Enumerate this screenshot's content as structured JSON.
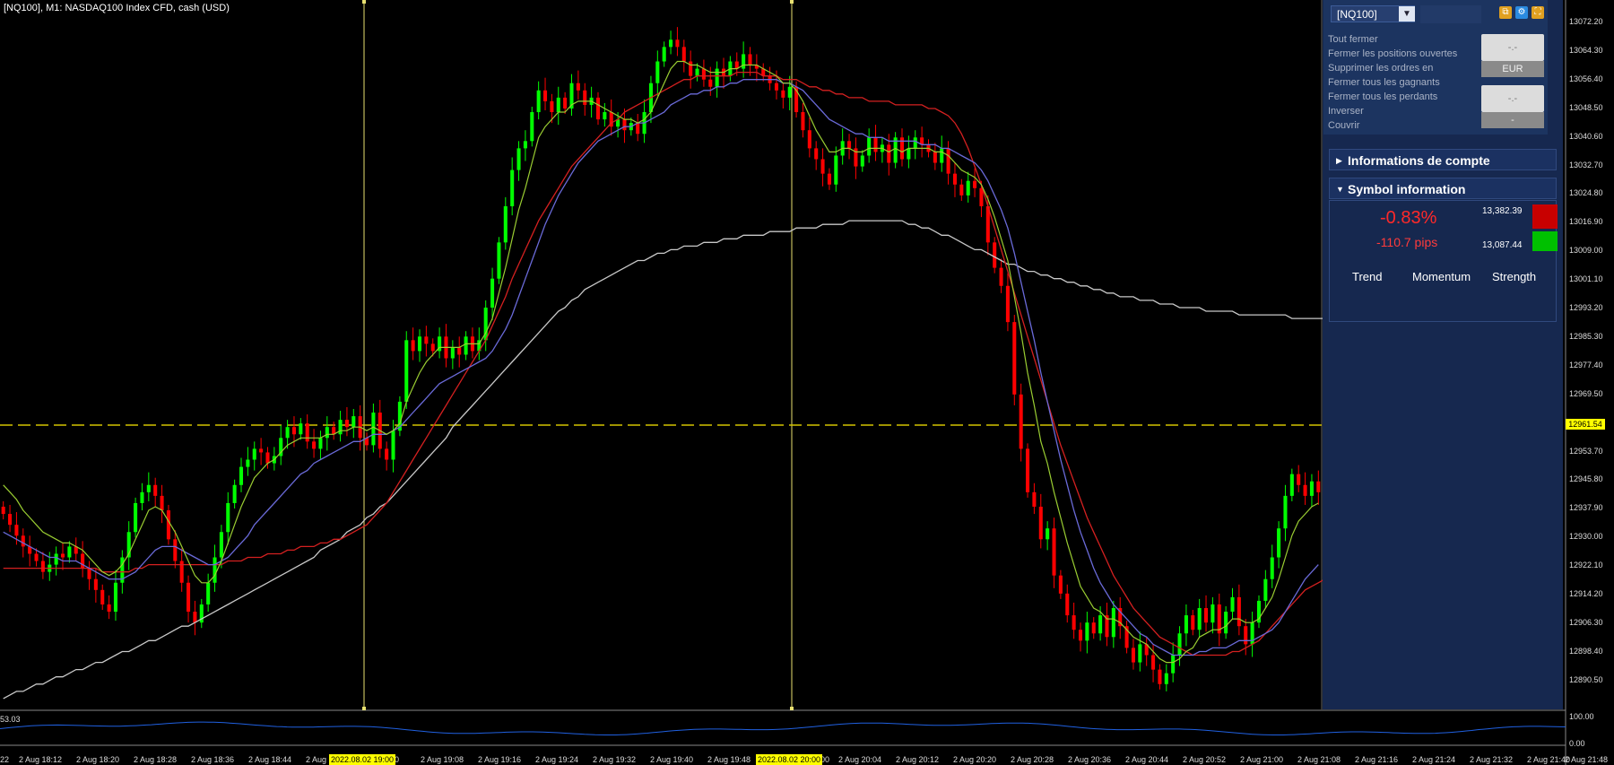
{
  "chart_title": "[NQ100], M1:  NASDAQ100 Index CFD, cash (USD)",
  "oscillator_label": "53.03",
  "colors": {
    "bull": "#00ff00",
    "bear": "#ff0000",
    "ma_fast": "#9acd32",
    "ma_mid": "#6a6ad8",
    "ma_slow": "#d42020",
    "ma_long": "#c8c8c8",
    "hline": "#d4c400",
    "vline": "#e8e070",
    "osc": "#2060e0",
    "panel": "#16284f"
  },
  "panel": {
    "symbol": "[NQ100]",
    "actions": [
      "Tout fermer",
      "Fermer les positions ouvertes",
      "Supprimer les ordres en",
      "Fermer tous les gagnants",
      "Fermer tous les perdants",
      "Inverser",
      "Couvrir"
    ],
    "btn1": "-.-",
    "btn1_sub": "EUR",
    "btn2": "-.-",
    "btn2_sub": "-",
    "section_account": "Informations de compte",
    "section_symbol": "Symbol information",
    "change_pct": "-0.83%",
    "change_pips": "-110.7 pips",
    "price_high": "13,382.39",
    "price_low": "13,087.44",
    "indicators": [
      "Trend",
      "Momentum",
      "Strength"
    ]
  },
  "price_axis": {
    "ticks": [
      "13072.20",
      "13064.30",
      "13056.40",
      "13048.50",
      "13040.60",
      "13032.70",
      "13024.80",
      "13016.90",
      "13009.00",
      "13001.10",
      "12993.20",
      "12985.30",
      "12977.40",
      "12969.50",
      "12961.54",
      "12953.70",
      "12945.80",
      "12937.90",
      "12930.00",
      "12922.10",
      "12914.20",
      "12906.30",
      "12898.40",
      "12890.50"
    ],
    "current": "12961.54"
  },
  "osc_axis": [
    "100.00",
    "0.00"
  ],
  "time_axis": {
    "ticks": [
      "22",
      "2 Aug 18:12",
      "2 Aug 18:20",
      "2 Aug 18:28",
      "2 Aug 18:36",
      "2 Aug 18:44",
      "2 Aug",
      "00",
      "2 Aug 19:08",
      "2 Aug 19:16",
      "2 Aug 19:24",
      "2 Aug 19:32",
      "2 Aug 19:40",
      "2 Aug 19:48",
      "00",
      "2 Aug 20:04",
      "2 Aug 20:12",
      "2 Aug 20:20",
      "2 Aug 20:28",
      "2 Aug 20:36",
      "2 Aug 20:44",
      "2 Aug 20:52",
      "2 Aug 21:00",
      "2 Aug 21:08",
      "2 Aug 21:16",
      "2 Aug 21:24",
      "2 Aug 21:32",
      "2 Aug 21:40",
      "2 Aug 21:48"
    ],
    "highlight1": "2022.08.02 19:00",
    "highlight2": "2022.08.02 20:00"
  },
  "chart_data": {
    "type": "candlestick",
    "title": "[NQ100], M1:  NASDAQ100 Index CFD, cash (USD)",
    "ylim": [
      12884,
      13076
    ],
    "current_price": 12961.54,
    "vertical_markers": [
      "2022.08.02 19:00",
      "2022.08.02 20:00"
    ],
    "close": [
      12937,
      12934,
      12931,
      12928,
      12926,
      12924,
      12921,
      12923,
      12926,
      12925,
      12928,
      12926,
      12922,
      12919,
      12916,
      12912,
      12910,
      12918,
      12925,
      12932,
      12940,
      12943,
      12945,
      12942,
      12938,
      12930,
      12924,
      12918,
      12910,
      12907,
      12912,
      12918,
      12925,
      12932,
      12940,
      12945,
      12950,
      12952,
      12955,
      12954,
      12951,
      12953,
      12958,
      12961,
      12959,
      12962,
      12957,
      12955,
      12958,
      12961,
      12959,
      12963,
      12961,
      12964,
      12958,
      12956,
      12965,
      12955,
      12952,
      12960,
      12968,
      12985,
      12982,
      12986,
      12984,
      12982,
      12986,
      12980,
      12983,
      12981,
      12986,
      12982,
      12985,
      12994,
      13002,
      13012,
      13022,
      13032,
      13038,
      13040,
      13048,
      13054,
      13051,
      13048,
      13052,
      13049,
      13056,
      13054,
      13050,
      13052,
      13046,
      13048,
      13044,
      13046,
      13043,
      13045,
      13042,
      13048,
      13056,
      13062,
      13066,
      13068,
      13066,
      13062,
      13058,
      13060,
      13057,
      13055,
      13060,
      13058,
      13062,
      13060,
      13064,
      13061,
      13060,
      13058,
      13056,
      13054,
      13052,
      13055,
      13048,
      13043,
      13038,
      13035,
      13031,
      13028,
      13036,
      13040,
      13038,
      13033,
      13036,
      13041,
      13037,
      13039,
      13034,
      13041,
      13035,
      13038,
      13041,
      13039,
      13037,
      13034,
      13038,
      13031,
      13028,
      13025,
      13029,
      13027,
      13022,
      13012,
      13005,
      13000,
      12990,
      12970,
      12955,
      12943,
      12939,
      12930,
      12933,
      12920,
      12915,
      12909,
      12905,
      12902,
      12907,
      12904,
      12909,
      12903,
      12911,
      12906,
      12900,
      12896,
      12901,
      12898,
      12894,
      12890,
      12893,
      12898,
      12904,
      12909,
      12905,
      12911,
      12907,
      12912,
      12904,
      12910,
      12914,
      12906,
      12901,
      12907,
      12913,
      12919,
      12925,
      12933,
      12942,
      12948,
      12945,
      12942,
      12946,
      12943
    ],
    "ma_fast": [
      12945,
      12943,
      12941,
      12938,
      12936,
      12934,
      12932,
      12931,
      12930,
      12929,
      12929,
      12928,
      12927,
      12925,
      12923,
      12921,
      12920,
      12921,
      12923,
      12926,
      12930,
      12934,
      12938,
      12939,
      12938,
      12935,
      12932,
      12928,
      12924,
      12920,
      12918,
      12918,
      12920,
      12924,
      12929,
      12934,
      12939,
      12943,
      12947,
      12949,
      12951,
      12952,
      12954,
      12956,
      12957,
      12958,
      12958,
      12958,
      12958,
      12959,
      12959,
      12960,
      12960,
      12961,
      12961,
      12960,
      12961,
      12960,
      12959,
      12960,
      12962,
      12968,
      12972,
      12976,
      12979,
      12981,
      12983,
      12983,
      12983,
      12983,
      12984,
      12984,
      12984,
      12987,
      12991,
      12998,
      13005,
      13013,
      13021,
      13027,
      13034,
      13041,
      13044,
      13046,
      13048,
      13048,
      13050,
      13051,
      13051,
      13051,
      13050,
      13049,
      13048,
      13047,
      13046,
      13046,
      13045,
      13046,
      13048,
      13052,
      13056,
      13060,
      13062,
      13062,
      13061,
      13061,
      13060,
      13059,
      13059,
      13059,
      13060,
      13060,
      13061,
      13061,
      13061,
      13060,
      13059,
      13058,
      13056,
      13056,
      13054,
      13051,
      13047,
      13043,
      13040,
      13037,
      13037,
      13038,
      13038,
      13037,
      13037,
      13038,
      13038,
      13038,
      13037,
      13038,
      13037,
      13038,
      13038,
      13038,
      13038,
      13037,
      13037,
      13036,
      13034,
      13032,
      13031,
      13030,
      13028,
      13024,
      13019,
      13013,
      13007,
      12997,
      12987,
      12976,
      12967,
      12957,
      12951,
      12943,
      12936,
      12929,
      12923,
      12917,
      12914,
      12911,
      12910,
      12908,
      12908,
      12907,
      12905,
      12903,
      12902,
      12901,
      12899,
      12897,
      12896,
      12896,
      12897,
      12899,
      12900,
      12903,
      12904,
      12905,
      12905,
      12906,
      12908,
      12908,
      12907,
      12907,
      12908,
      12911,
      12914,
      12919,
      12925,
      12931,
      12935,
      12937,
      12939,
      12940
    ],
    "ma_mid": [
      12932,
      12931,
      12930,
      12929,
      12928,
      12927,
      12926,
      12925,
      12925,
      12924,
      12924,
      12924,
      12923,
      12922,
      12921,
      12920,
      12919,
      12919,
      12919,
      12920,
      12921,
      12923,
      12925,
      12927,
      12928,
      12928,
      12928,
      12927,
      12926,
      12925,
      12924,
      12923,
      12923,
      12924,
      12925,
      12927,
      12929,
      12931,
      12934,
      12936,
      12938,
      12940,
      12942,
      12944,
      12946,
      12948,
      12949,
      12951,
      12952,
      12953,
      12954,
      12955,
      12956,
      12957,
      12957,
      12958,
      12959,
      12959,
      12959,
      12960,
      12961,
      12963,
      12965,
      12967,
      12969,
      12971,
      12973,
      12974,
      12975,
      12976,
      12977,
      12978,
      12979,
      12980,
      12982,
      12985,
      12988,
      12992,
      12997,
      13002,
      13007,
      13012,
      13017,
      13021,
      13025,
      13028,
      13031,
      13034,
      13036,
      13038,
      13040,
      13041,
      13042,
      13043,
      13044,
      13044,
      13045,
      13045,
      13046,
      13047,
      13048,
      13050,
      13051,
      13052,
      13053,
      13053,
      13054,
      13054,
      13055,
      13055,
      13056,
      13056,
      13057,
      13057,
      13057,
      13057,
      13057,
      13057,
      13056,
      13056,
      13055,
      13054,
      13052,
      13050,
      13048,
      13046,
      13045,
      13044,
      13043,
      13042,
      13042,
      13041,
      13041,
      13041,
      13040,
      13040,
      13040,
      13040,
      13040,
      13039,
      13039,
      13039,
      13038,
      13038,
      13037,
      13036,
      13035,
      13034,
      13032,
      13029,
      13025,
      13021,
      13016,
      13009,
      13001,
      12993,
      12985,
      12976,
      12968,
      12960,
      12952,
      12945,
      12938,
      12932,
      12927,
      12922,
      12918,
      12915,
      12912,
      12910,
      12908,
      12906,
      12904,
      12903,
      12901,
      12900,
      12899,
      12898,
      12898,
      12898,
      12898,
      12899,
      12899,
      12900,
      12900,
      12900,
      12901,
      12902,
      12902,
      12902,
      12903,
      12904,
      12905,
      12907,
      12910,
      12913,
      12916,
      12919,
      12921,
      12923
    ],
    "ma_slow": [
      12922,
      12922,
      12922,
      12922,
      12922,
      12922,
      12922,
      12922,
      12922,
      12922,
      12922,
      12922,
      12922,
      12922,
      12922,
      12921,
      12921,
      12921,
      12921,
      12921,
      12922,
      12922,
      12923,
      12923,
      12923,
      12923,
      12923,
      12923,
      12923,
      12923,
      12923,
      12923,
      12923,
      12923,
      12924,
      12924,
      12924,
      12925,
      12925,
      12925,
      12926,
      12926,
      12926,
      12927,
      12927,
      12928,
      12928,
      12928,
      12929,
      12929,
      12930,
      12930,
      12931,
      12932,
      12933,
      12934,
      12936,
      12938,
      12940,
      12943,
      12946,
      12949,
      12952,
      12955,
      12958,
      12961,
      12964,
      12967,
      12970,
      12973,
      12976,
      12979,
      12982,
      12985,
      12989,
      12993,
      12997,
      13002,
      13006,
      13010,
      13014,
      13018,
      13021,
      13024,
      13027,
      13030,
      13033,
      13035,
      13037,
      13039,
      13041,
      13043,
      13045,
      13046,
      13048,
      13049,
      13050,
      13051,
      13052,
      13053,
      13054,
      13055,
      13056,
      13057,
      13057,
      13058,
      13058,
      13058,
      13058,
      13058,
      13058,
      13059,
      13059,
      13059,
      13059,
      13058,
      13058,
      13058,
      13057,
      13057,
      13057,
      13056,
      13055,
      13055,
      13054,
      13054,
      13053,
      13053,
      13052,
      13052,
      13052,
      13051,
      13051,
      13051,
      13051,
      13050,
      13050,
      13050,
      13050,
      13050,
      13049,
      13049,
      13048,
      13047,
      13045,
      13042,
      13038,
      13033,
      13028,
      13022,
      13016,
      13010,
      13004,
      12998,
      12992,
      12986,
      12980,
      12974,
      12968,
      12962,
      12956,
      12951,
      12946,
      12941,
      12936,
      12932,
      12928,
      12924,
      12920,
      12917,
      12914,
      12911,
      12909,
      12907,
      12905,
      12903,
      12902,
      12901,
      12900,
      12899,
      12898,
      12898,
      12898,
      12898,
      12898,
      12898,
      12899,
      12899,
      12900,
      12901,
      12902,
      12904,
      12906,
      12908,
      12910,
      12912,
      12914,
      12916,
      12917,
      12918,
      12919,
      12920
    ],
    "ma_long": [
      12886,
      12887,
      12888,
      12888,
      12889,
      12890,
      12890,
      12891,
      12892,
      12892,
      12893,
      12894,
      12894,
      12895,
      12896,
      12896,
      12897,
      12898,
      12899,
      12899,
      12900,
      12901,
      12902,
      12902,
      12903,
      12904,
      12905,
      12906,
      12906,
      12907,
      12908,
      12909,
      12910,
      12911,
      12912,
      12913,
      12914,
      12915,
      12916,
      12917,
      12918,
      12919,
      12920,
      12921,
      12922,
      12923,
      12924,
      12925,
      12927,
      12928,
      12929,
      12930,
      12932,
      12933,
      12934,
      12936,
      12937,
      12939,
      12940,
      12942,
      12944,
      12946,
      12948,
      12950,
      12952,
      12954,
      12956,
      12958,
      12961,
      12963,
      12965,
      12967,
      12969,
      12971,
      12973,
      12975,
      12977,
      12979,
      12981,
      12983,
      12985,
      12987,
      12989,
      12991,
      12993,
      12994,
      12996,
      12997,
      12999,
      13000,
      13001,
      13002,
      13003,
      13004,
      13005,
      13006,
      13007,
      13007,
      13008,
      13009,
      13009,
      13010,
      13010,
      13011,
      13011,
      13011,
      13012,
      13012,
      13012,
      13013,
      13013,
      13013,
      13014,
      13014,
      13014,
      13014,
      13015,
      13015,
      13015,
      13015,
      13016,
      13016,
      13016,
      13016,
      13017,
      13017,
      13017,
      13017,
      13018,
      13018,
      13018,
      13018,
      13018,
      13018,
      13018,
      13018,
      13018,
      13017,
      13017,
      13016,
      13016,
      13015,
      13014,
      13014,
      13013,
      13012,
      13011,
      13010,
      13010,
      13009,
      13008,
      13007,
      13006,
      13006,
      13005,
      13004,
      13004,
      13003,
      13003,
      13002,
      13002,
      13001,
      13001,
      13000,
      13000,
      12999,
      12999,
      12998,
      12998,
      12997,
      12997,
      12997,
      12996,
      12996,
      12996,
      12995,
      12995,
      12995,
      12994,
      12994,
      12994,
      12994,
      12993,
      12993,
      12993,
      12993,
      12993,
      12992,
      12992,
      12992,
      12992,
      12992,
      12992,
      12992,
      12992,
      12991,
      12991,
      12991,
      12991,
      12991,
      12991,
      12991,
      12991,
      12991,
      12990,
      12990,
      12990,
      12990
    ],
    "oscillator": {
      "range": [
        0,
        100
      ],
      "last": 53.03
    }
  }
}
